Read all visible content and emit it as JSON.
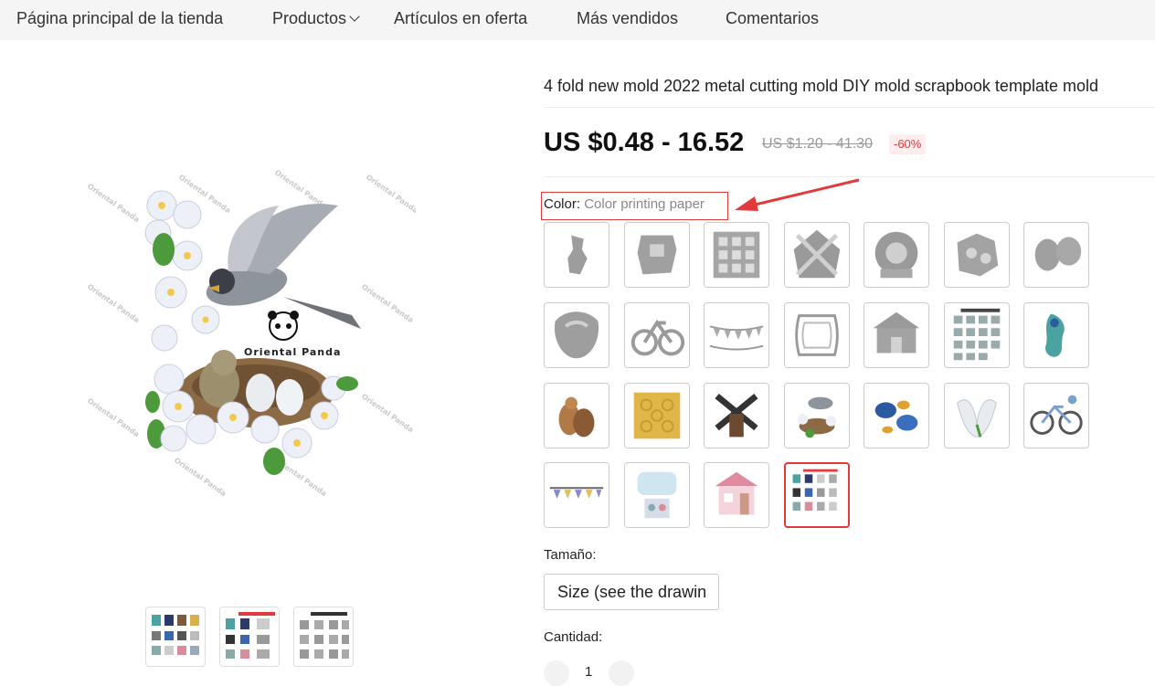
{
  "nav": {
    "items": [
      {
        "label": "Página principal de la tienda"
      },
      {
        "label": "Productos"
      },
      {
        "label": "Artículos en oferta"
      },
      {
        "label": "Más vendidos"
      },
      {
        "label": "Comentarios"
      }
    ]
  },
  "main_image": {
    "watermark": "Oriental Panda",
    "brand_text": "Oriental Panda"
  },
  "product": {
    "title": "4 fold new mold 2022 metal cutting mold DIY mold scrapbook template mold",
    "price": "US $0.48 - 16.52",
    "original_price": "US $1.20 - 41.30",
    "discount": "-60%"
  },
  "color": {
    "label": "Color:",
    "selected_value": "Color printing paper"
  },
  "size": {
    "label": "Tamaño:",
    "selected": "Size (see the drawin"
  },
  "quantity": {
    "label": "Cantidad:",
    "value": "1"
  },
  "colors": {
    "accent": "#e4393c",
    "annotation_red": "#e23a3a"
  }
}
